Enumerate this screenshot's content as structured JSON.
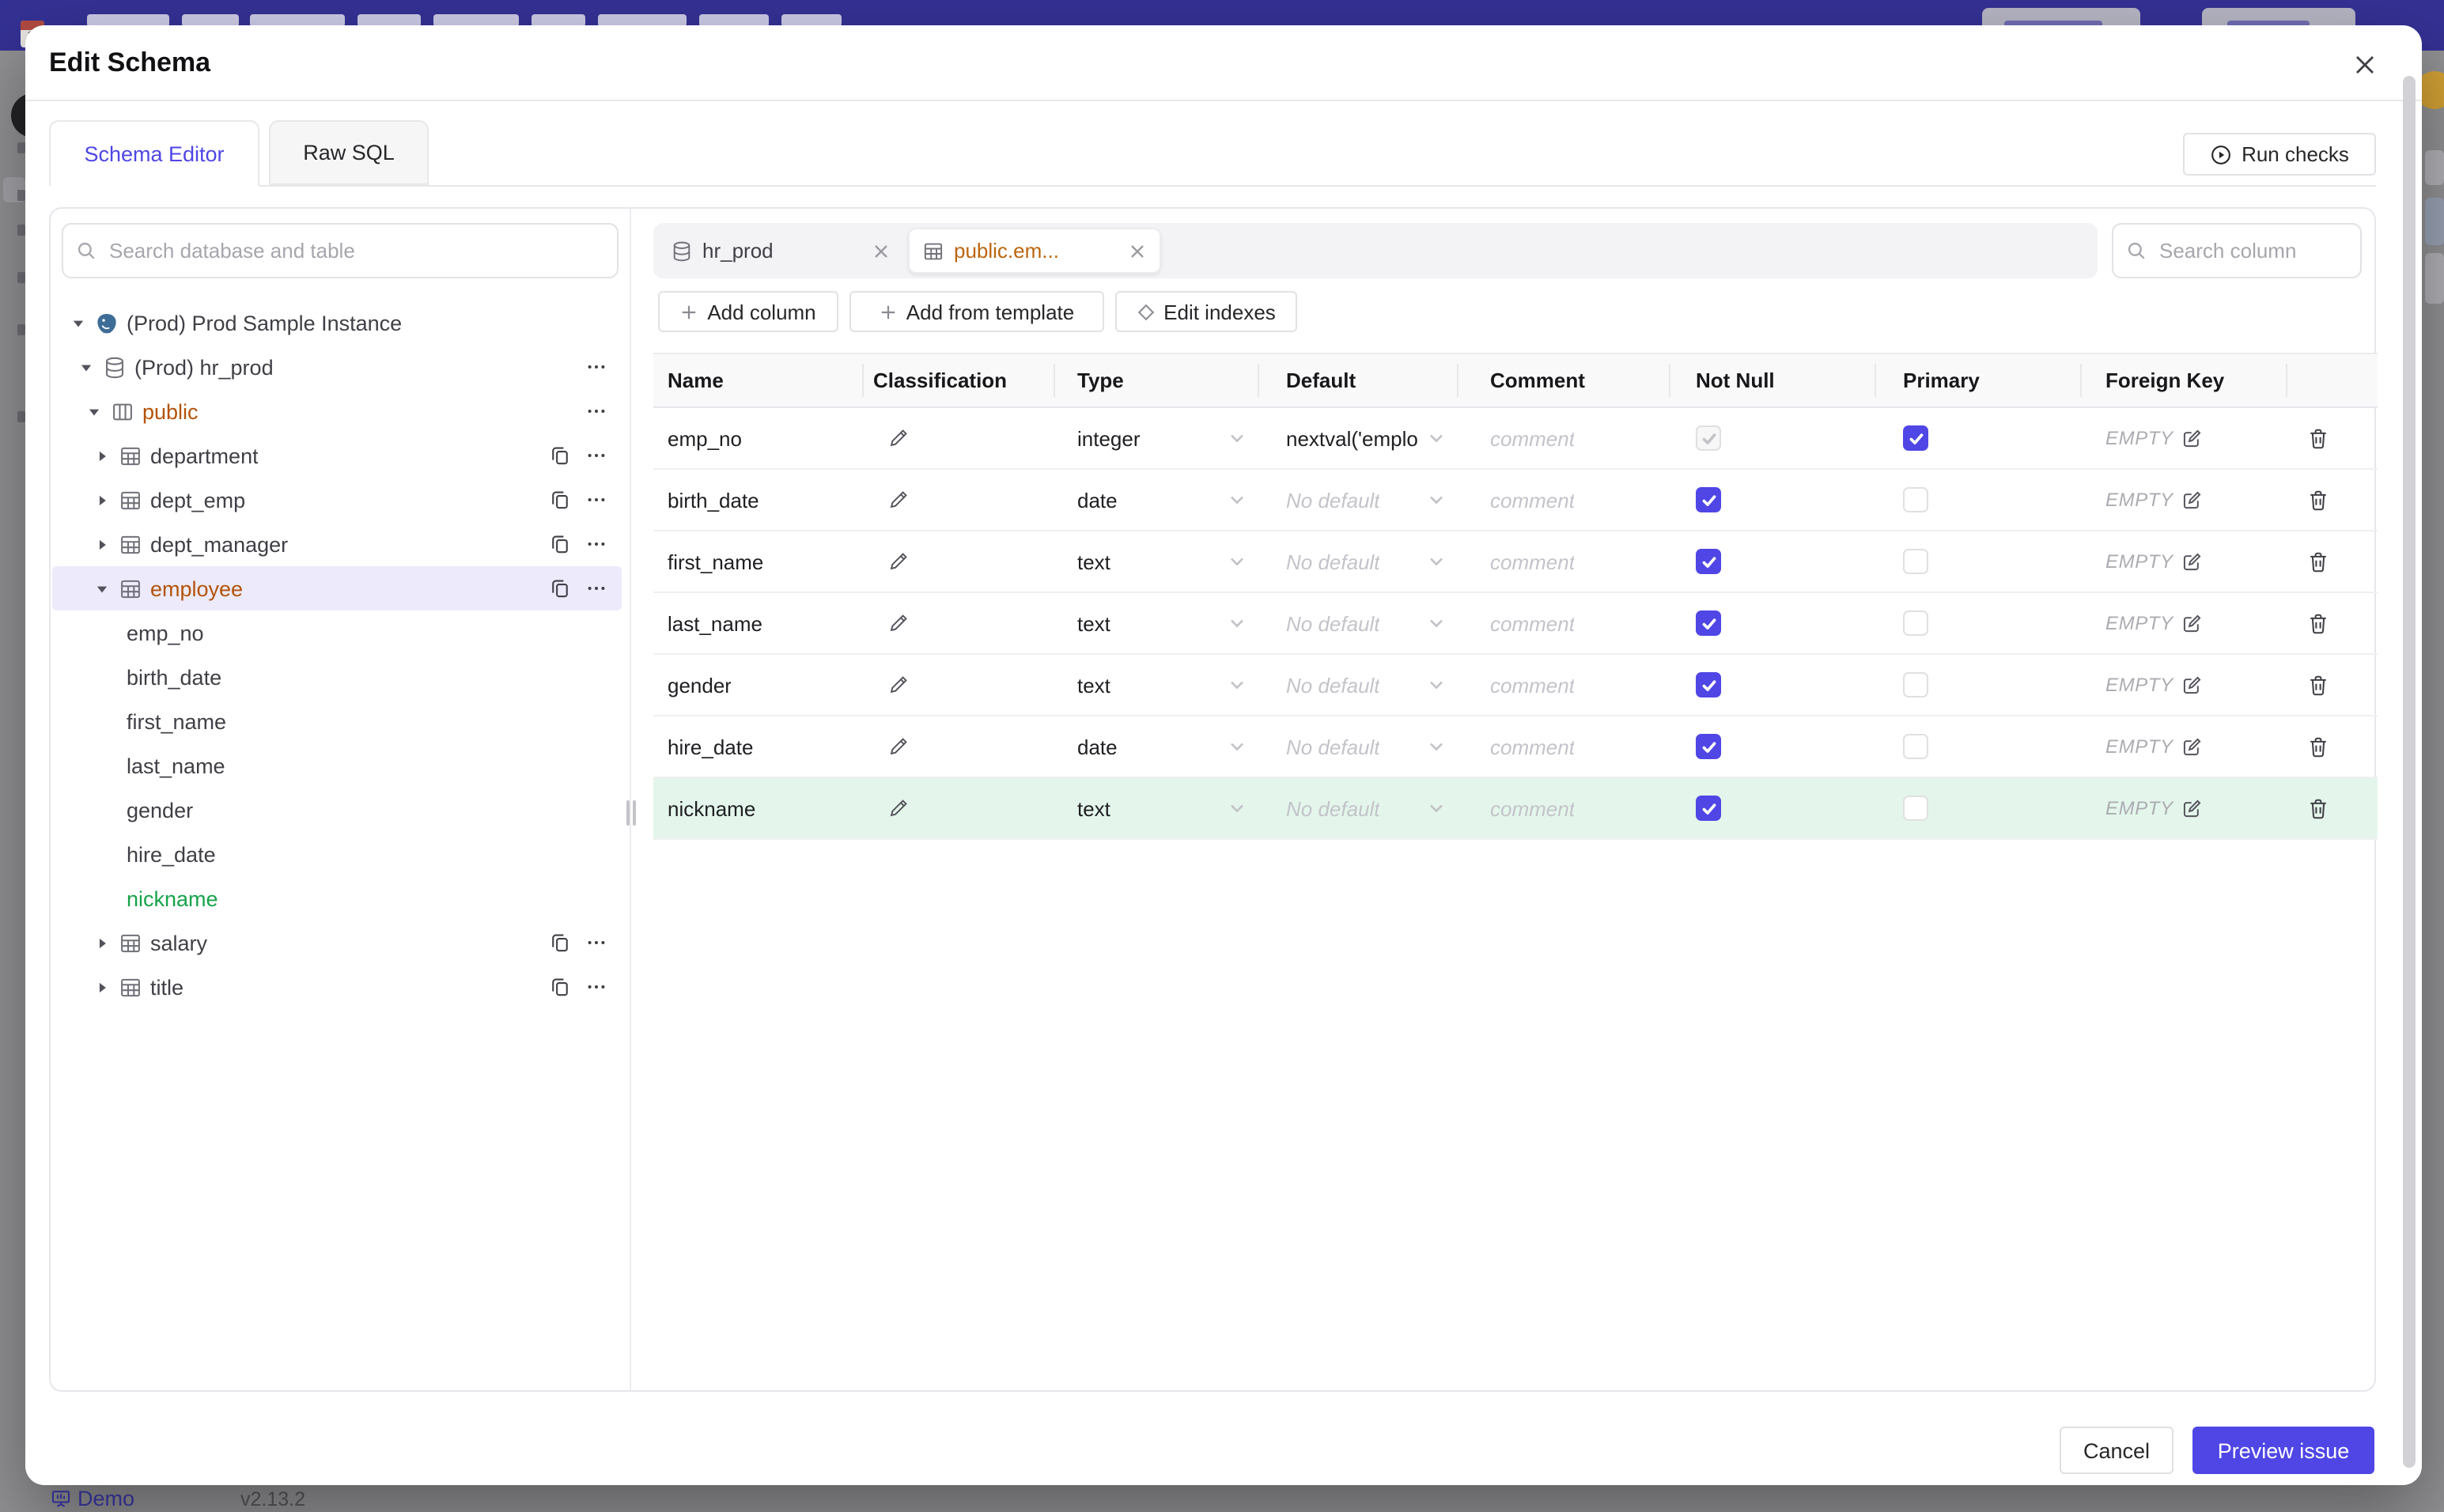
{
  "statusbar": {
    "demo_label": "Demo",
    "version": "v2.13.2"
  },
  "colors": {
    "accent": "#4f46e5",
    "modified": "#b45309",
    "added": "#16a34a",
    "added_row_bg": "#e4f6eb"
  },
  "modal": {
    "title": "Edit Schema",
    "tabs": [
      {
        "id": "schema-editor",
        "label": "Schema Editor",
        "active": true
      },
      {
        "id": "raw-sql",
        "label": "Raw SQL",
        "active": false
      }
    ],
    "run_checks_label": "Run checks",
    "sidebar": {
      "search_placeholder": "Search database and table",
      "nodes": [
        {
          "label": "(Prod) Prod Sample Instance",
          "depth": 0,
          "caret": "down",
          "icon": "instance",
          "actions": []
        },
        {
          "label": "(Prod) hr_prod",
          "depth": 1,
          "caret": "down",
          "icon": "database",
          "actions": [
            "more"
          ]
        },
        {
          "label": "public",
          "depth": 2,
          "caret": "down",
          "icon": "schema",
          "state": "modified",
          "actions": [
            "more"
          ]
        },
        {
          "label": "department",
          "depth": 3,
          "caret": "right",
          "icon": "table",
          "actions": [
            "copy",
            "more"
          ]
        },
        {
          "label": "dept_emp",
          "depth": 3,
          "caret": "right",
          "icon": "table",
          "actions": [
            "copy",
            "more"
          ]
        },
        {
          "label": "dept_manager",
          "depth": 3,
          "caret": "right",
          "icon": "table",
          "actions": [
            "copy",
            "more"
          ]
        },
        {
          "label": "employee",
          "depth": 3,
          "caret": "down",
          "icon": "table",
          "state": "modified",
          "selected": true,
          "actions": [
            "copy",
            "more"
          ]
        },
        {
          "label": "emp_no",
          "depth": 4
        },
        {
          "label": "birth_date",
          "depth": 4
        },
        {
          "label": "first_name",
          "depth": 4
        },
        {
          "label": "last_name",
          "depth": 4
        },
        {
          "label": "gender",
          "depth": 4
        },
        {
          "label": "hire_date",
          "depth": 4
        },
        {
          "label": "nickname",
          "depth": 4,
          "state": "added"
        },
        {
          "label": "salary",
          "depth": 3,
          "caret": "right",
          "icon": "table",
          "actions": [
            "copy",
            "more"
          ]
        },
        {
          "label": "title",
          "depth": 3,
          "caret": "right",
          "icon": "table",
          "actions": [
            "copy",
            "more"
          ]
        }
      ]
    },
    "editor": {
      "chips": [
        {
          "label": "hr_prod",
          "icon": "database",
          "active": false
        },
        {
          "label": "public.em...",
          "icon": "table",
          "active": true
        }
      ],
      "column_search_placeholder": "Search column",
      "toolbar": [
        {
          "id": "add-column",
          "icon": "plus",
          "label": "Add column"
        },
        {
          "id": "add-from-template",
          "icon": "plus",
          "label": "Add from template"
        },
        {
          "id": "edit-indexes",
          "icon": "diamond",
          "label": "Edit indexes"
        }
      ],
      "table": {
        "headers": [
          "Name",
          "Classification",
          "Type",
          "Default",
          "Comment",
          "Not Null",
          "Primary",
          "Foreign Key",
          ""
        ],
        "comment_placeholder": "comment",
        "no_default_label": "No default",
        "foreign_key_label": "EMPTY",
        "rows": [
          {
            "name": "emp_no",
            "type": "integer",
            "default": "nextval('employ",
            "has_default": true,
            "not_null": "checked-disabled",
            "primary": "checked",
            "state": "normal"
          },
          {
            "name": "birth_date",
            "type": "date",
            "default": "",
            "has_default": false,
            "not_null": "checked",
            "primary": "unchecked",
            "state": "normal"
          },
          {
            "name": "first_name",
            "type": "text",
            "default": "",
            "has_default": false,
            "not_null": "checked",
            "primary": "unchecked",
            "state": "normal"
          },
          {
            "name": "last_name",
            "type": "text",
            "default": "",
            "has_default": false,
            "not_null": "checked",
            "primary": "unchecked",
            "state": "normal"
          },
          {
            "name": "gender",
            "type": "text",
            "default": "",
            "has_default": false,
            "not_null": "checked",
            "primary": "unchecked",
            "state": "normal"
          },
          {
            "name": "hire_date",
            "type": "date",
            "default": "",
            "has_default": false,
            "not_null": "checked",
            "primary": "unchecked",
            "state": "normal"
          },
          {
            "name": "nickname",
            "type": "text",
            "default": "",
            "has_default": false,
            "not_null": "checked",
            "primary": "unchecked",
            "state": "added"
          }
        ]
      }
    },
    "footer": {
      "cancel_label": "Cancel",
      "primary_label": "Preview issue"
    }
  }
}
